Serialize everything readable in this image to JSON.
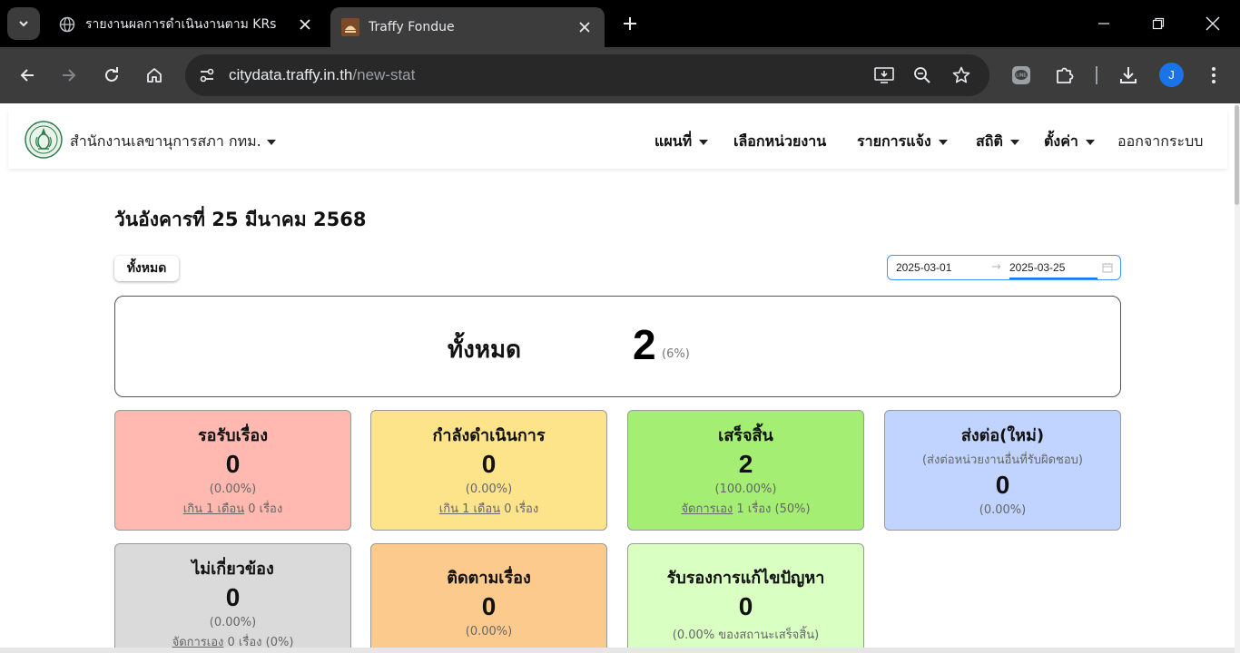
{
  "browser": {
    "tabs": [
      {
        "title": "รายงานผลการดำเนินงานตาม KRs",
        "favicon": "globe-icon",
        "active": false
      },
      {
        "title": "Traffy Fondue",
        "favicon": "traffy-icon",
        "active": true
      }
    ],
    "url_host": "citydata.traffy.in.th",
    "url_path": "/new-stat",
    "profile_initial": "J"
  },
  "navbar": {
    "org": "สำนักงานเลขานุการสภา กทม.",
    "menu": {
      "map": "แผนที่",
      "select_unit": "เลือกหน่วยงาน",
      "reports": "รายการแจ้ง",
      "stats": "สถิติ",
      "settings": "ตั้งค่า",
      "logout": "ออกจากระบบ"
    }
  },
  "main": {
    "date_title": "วันอังคารที่ 25 มีนาคม 2568",
    "all_button": "ทั้งหมด",
    "range": {
      "start": "2025-03-01",
      "separator": "→",
      "end": "2025-03-25"
    },
    "total": {
      "label": "ทั้งหมด",
      "value": "2",
      "pct": "(6%)"
    },
    "cards": {
      "pending": {
        "title": "รอรับเรื่อง",
        "value": "0",
        "pct": "(0.00%)",
        "note_link": "เกิน 1 เดือน",
        "note_text": " 0 เรื่อง",
        "color": "#ffb9b1"
      },
      "inprogress": {
        "title": "กำลังดำเนินการ",
        "value": "0",
        "pct": "(0.00%)",
        "note_link": "เกิน 1 เดือน",
        "note_text": " 0 เรื่อง",
        "color": "#fde38a"
      },
      "done": {
        "title": "เสร็จสิ้น",
        "value": "2",
        "pct": "(100.00%)",
        "note_link": "จัดการเอง",
        "note_text": " 1 เรื่อง (50%)",
        "color": "#a4ee74"
      },
      "forward": {
        "title": "ส่งต่อ(ใหม่)",
        "subtitle": "(ส่งต่อหน่วยงานอื่นที่รับผิดชอบ)",
        "value": "0",
        "pct": "(0.00%)",
        "color": "#c0d4ff"
      },
      "unrelated": {
        "title": "ไม่เกี่ยวข้อง",
        "value": "0",
        "pct": "(0.00%)",
        "note_link": "จัดการเอง",
        "note_text": " 0 เรื่อง (0%)",
        "color": "#dadada"
      },
      "follow": {
        "title": "ติดตามเรื่อง",
        "value": "0",
        "pct": "(0.00%)",
        "color": "#fdca8e"
      },
      "accept": {
        "title": "รับรองการแก้ไขปัญหา",
        "value": "0",
        "pct": "(0.00% ของสถานะเสร็จสิ้น)",
        "color": "#d9ffc2"
      }
    }
  }
}
